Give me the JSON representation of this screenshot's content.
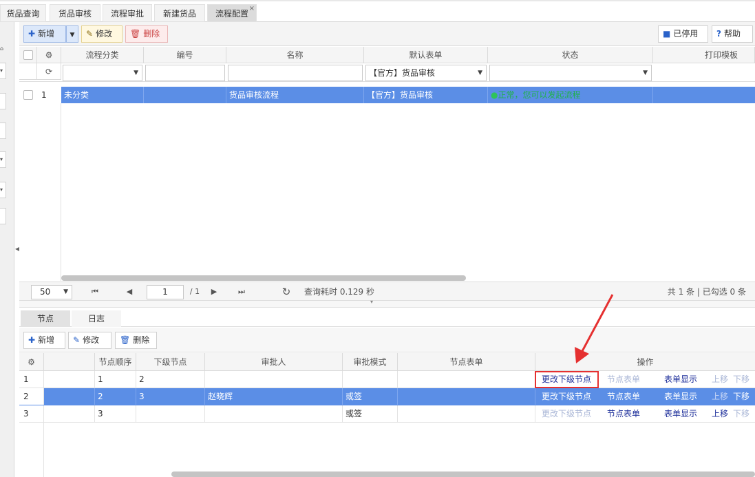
{
  "tabs": [
    {
      "label": "货品查询"
    },
    {
      "label": "货品审核"
    },
    {
      "label": "流程审批"
    },
    {
      "label": "新建货品"
    },
    {
      "label": "流程配置",
      "close": "×"
    }
  ],
  "toolbar": {
    "add": "新增",
    "edit": "修改",
    "delete": "删除",
    "disabled": "已停用",
    "help": "帮助"
  },
  "grid": {
    "columns": [
      "流程分类",
      "编号",
      "名称",
      "默认表单",
      "状态",
      "打印模板"
    ],
    "filter_form_value": "【官方】货品审核",
    "rows": [
      {
        "num": "1",
        "category": "未分类",
        "code": "",
        "name": "货品审核流程",
        "form": "【官方】货品审核",
        "status": "正常，您可以发起流程",
        "template": ""
      }
    ]
  },
  "pager": {
    "page_size": "50",
    "page": "1",
    "total_pages": "/ 1",
    "query_time": "查询耗时 0.129 秒",
    "summary": "共 1 条 | 已勾选 0 条"
  },
  "subtabs": [
    {
      "label": "节点"
    },
    {
      "label": "日志"
    }
  ],
  "node_toolbar": {
    "add": "新增",
    "edit": "修改",
    "delete": "删除"
  },
  "node_grid": {
    "columns": [
      "节点顺序",
      "下级节点",
      "审批人",
      "审批模式",
      "节点表单",
      "操作"
    ],
    "actions": [
      "更改下级节点",
      "节点表单",
      "表单显示",
      "上移",
      "下移"
    ],
    "rows": [
      {
        "num": "1",
        "order": "1",
        "next": "2",
        "approver": "",
        "mode": ""
      },
      {
        "num": "2",
        "order": "2",
        "next": "3",
        "approver": "赵晓辉",
        "mode": "或签"
      },
      {
        "num": "3",
        "order": "3",
        "next": "",
        "approver": "",
        "mode": "或签"
      }
    ]
  },
  "colors": {
    "accent": "#5b8ee6",
    "highlight": "#e53030",
    "link": "#1d2e9a",
    "status_ok": "#2fc35a"
  }
}
